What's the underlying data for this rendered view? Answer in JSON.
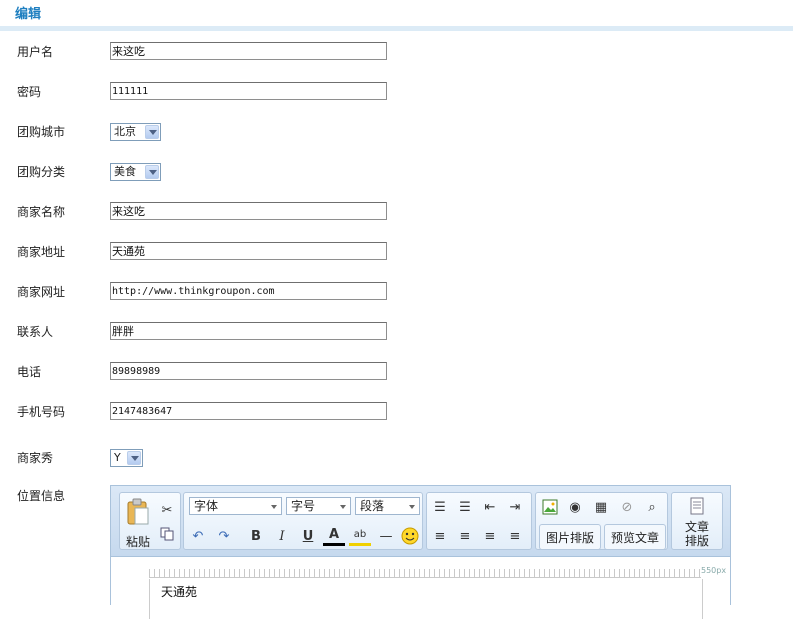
{
  "header": {
    "title": "编辑"
  },
  "form": {
    "username": {
      "label": "用户名",
      "value": "来这吃"
    },
    "password": {
      "label": "密码",
      "value": "111111"
    },
    "city": {
      "label": "团购城市",
      "value": "北京"
    },
    "category": {
      "label": "团购分类",
      "value": "美食"
    },
    "shop_name": {
      "label": "商家名称",
      "value": "来这吃"
    },
    "shop_address": {
      "label": "商家地址",
      "value": "天通苑"
    },
    "shop_url": {
      "label": "商家网址",
      "value": "http://www.thinkgroupon.com"
    },
    "contact": {
      "label": "联系人",
      "value": "胖胖"
    },
    "phone": {
      "label": "电话",
      "value": "89898989"
    },
    "mobile": {
      "label": "手机号码",
      "value": "2147483647"
    },
    "shop_show": {
      "label": "商家秀",
      "value": "Y"
    },
    "location": {
      "label": "位置信息"
    }
  },
  "editor": {
    "paste_label": "粘贴",
    "font_family": "字体",
    "font_size": "字号",
    "paragraph": "段落",
    "image_layout": "图片排版",
    "preview": "预览文章",
    "article_layout": "文章排版",
    "ruler_label": "550px",
    "content_text": "天通苑"
  },
  "colors": {
    "accent": "#1e7fc0",
    "title_bar": "#dcebf6",
    "toolbar_bg": "#c6d9ee"
  }
}
